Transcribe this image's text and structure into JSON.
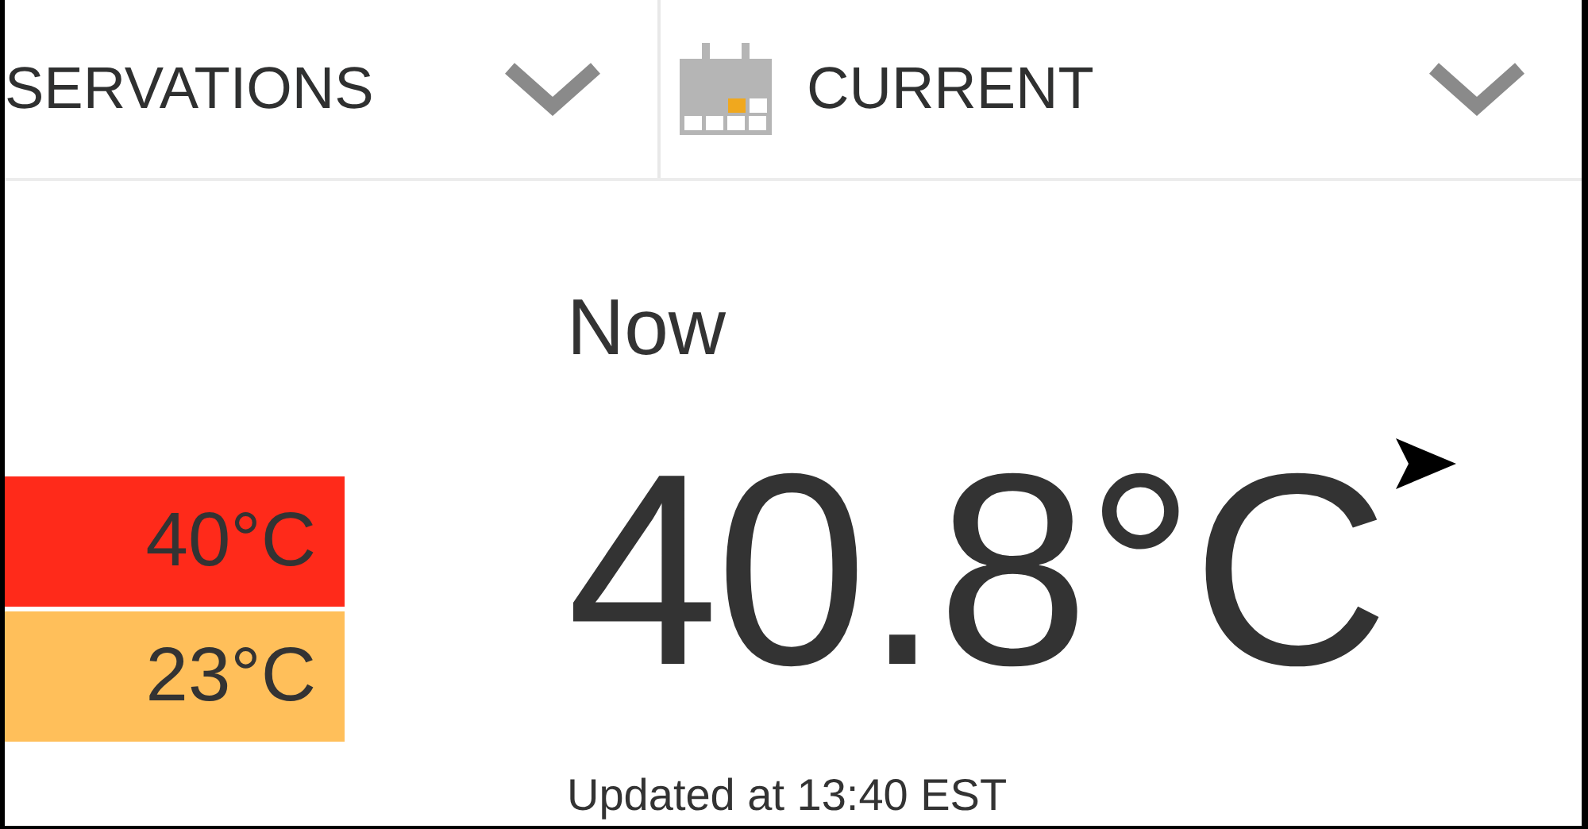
{
  "header": {
    "dropdowns": [
      {
        "label": "SERVATIONS",
        "icon": false
      },
      {
        "label": "CURRENT",
        "icon": true
      }
    ]
  },
  "temperatures": [
    {
      "value": "40°C",
      "color": "#ff2a1a"
    },
    {
      "value": "23°C",
      "color": "#ffbf5a"
    }
  ],
  "current": {
    "heading": "Now",
    "temperature": "40.8°C",
    "updated": "Updated at 13:40 EST"
  }
}
